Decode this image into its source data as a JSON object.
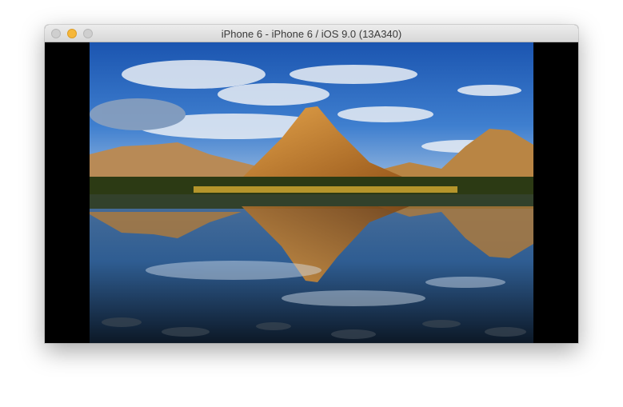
{
  "window": {
    "title": "iPhone 6 - iPhone 6 / iOS 9.0 (13A340)",
    "controls": {
      "close": {
        "icon": "close-button-icon",
        "color": "#cfcfcf"
      },
      "minimize": {
        "icon": "minimize-button-icon",
        "color": "#f6b73a"
      },
      "zoom": {
        "icon": "zoom-button-icon",
        "color": "#cfcfcf"
      }
    }
  },
  "screen": {
    "background": "#000000",
    "wallpaper": {
      "subject": "mountain-lake-reflection",
      "colors": {
        "sky_top": "#1f5fbf",
        "sky_bottom": "#8fb3dc",
        "peak": "#c9852e",
        "water_deep": "#0c1a2a"
      }
    }
  }
}
